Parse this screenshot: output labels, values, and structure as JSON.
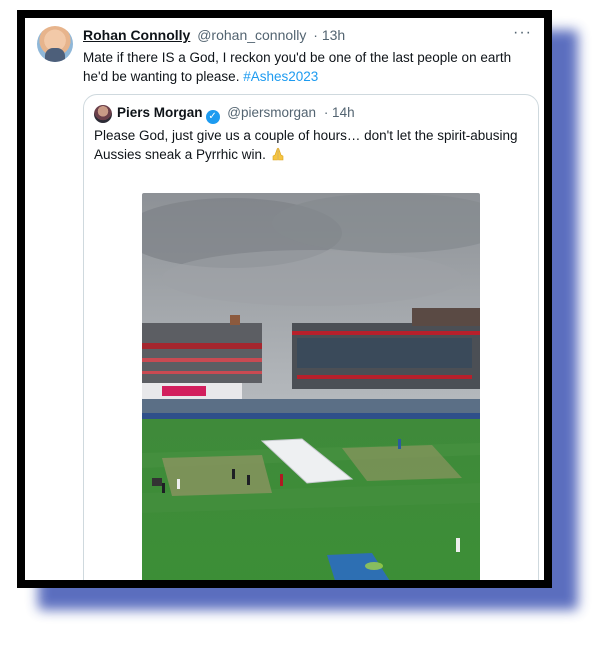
{
  "tweet": {
    "author_name": "Rohan Connolly",
    "author_handle": "@rohan_connolly",
    "time": "· 13h",
    "text": "Mate if there IS a God, I reckon you'd be one of the last people on earth he'd be wanting to please.",
    "hashtag": "#Ashes2023",
    "more_icon": "more-icon"
  },
  "quoted": {
    "author_name": "Piers Morgan",
    "author_handle": "@piersmorgan",
    "time": "· 14h",
    "text": "Please God, just give us a couple of hours… don't let the spirit-abusing Aussies sneak a Pyrrhic win.",
    "emoji": "praying-hands-icon",
    "verified_icon": "verified-badge-icon"
  },
  "colors": {
    "accent": "#1d9bf0",
    "frame": "#000000",
    "shadow": "#4a5fb8"
  }
}
